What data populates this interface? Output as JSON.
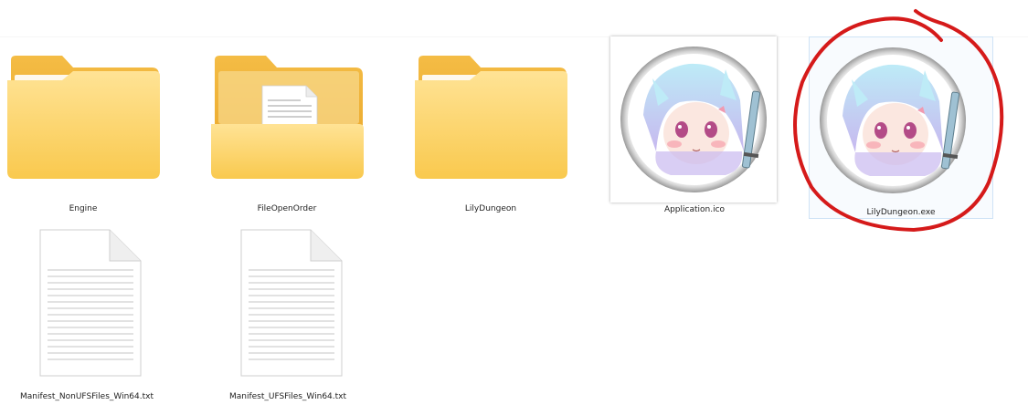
{
  "files": [
    {
      "name": "Engine",
      "icon": "folder-icon"
    },
    {
      "name": "FileOpenOrder",
      "icon": "folder-with-document-icon"
    },
    {
      "name": "LilyDungeon",
      "icon": "folder-icon"
    },
    {
      "name": "Application.ico",
      "icon": "anime-avatar-icon"
    },
    {
      "name": "LilyDungeon.exe",
      "icon": "anime-avatar-icon",
      "selected": true
    },
    {
      "name": "Manifest_NonUFSFiles_Win64.txt",
      "icon": "text-document-icon"
    },
    {
      "name": "Manifest_UFSFiles_Win64.txt",
      "icon": "text-document-icon"
    }
  ],
  "colors": {
    "folder_back": "#F2B63C",
    "folder_front": "#FCD877",
    "annotation": "#D51A1A",
    "selection": "#CFE3F6"
  }
}
